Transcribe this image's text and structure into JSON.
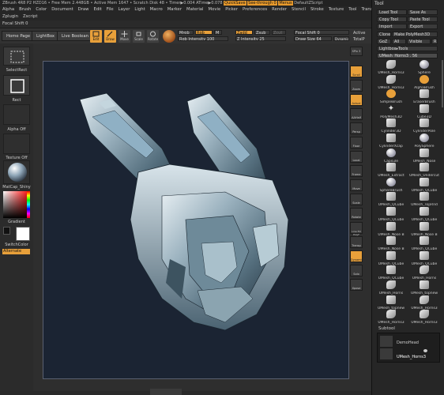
{
  "titlebar": {
    "app": "ZBrush 4R8 P2 HZD16",
    "stats": "• Free Mem 2.448GB • Active Mem 1647 • Scratch Disk 48 • Timer▶0.004 ATime▶0.078",
    "quicksave": "QuickSave",
    "seethrough": "See-through  0",
    "menus": "Menus",
    "script": "DefaultZScript"
  },
  "menus": {
    "row1": [
      "Alpha",
      "Brush",
      "Color",
      "Document",
      "Draw",
      "Edit",
      "File",
      "Layer",
      "Light",
      "Macro",
      "Marker",
      "Material",
      "Movie",
      "Picker",
      "Preferences",
      "Render",
      "Stencil",
      "Stroke",
      "Texture",
      "Tool",
      "Transform"
    ],
    "row2": [
      "Zplugin",
      "Zscript"
    ],
    "focal": "Focal Shift 0"
  },
  "topbar": {
    "tabs": [
      "Home Page",
      "LightBox",
      "Live Boolean"
    ],
    "edit": "Edit",
    "draw": "Draw",
    "move": "Move",
    "scale": "Scale",
    "rotate": "Rotate",
    "mrgb": "Mrgb",
    "rgb": "Rgb",
    "m": "M",
    "rgb_intensity": "Rgb Intensity 100",
    "zadd": "Zadd",
    "zsub": "Zsub",
    "zcut": "Zcut",
    "z_intensity": "Z Intensity 25",
    "focal_shift": "Focal Shift 0",
    "draw_size": "Draw Size 64",
    "dynamic": "Dynamic",
    "active": "Active",
    "total": "TotalP"
  },
  "left_shelf": {
    "select": "SelectRect",
    "rect": "Rect",
    "alpha": "Alpha Off",
    "texture": "Texture Off",
    "material": "MatCap_Shiny",
    "gradient": "Gradient",
    "switchcolor": "SwitchColor",
    "alternate": "Alternate"
  },
  "right_shelf": [
    "SPix 3",
    "Scroll",
    "Zoom",
    "Actual",
    "AAHalf",
    "Persp",
    "Floor",
    "Local",
    "Frame",
    "Move",
    "Scale",
    "Rotate",
    "Line Fill PolyF",
    "Transp",
    "Dynamic",
    "Solo",
    "Xpose"
  ],
  "tool_panel": {
    "title": "Tool",
    "load_tool": "Load Tool",
    "save_as": "Save As",
    "copy_tool": "Copy Tool",
    "paste_tool": "Paste Tool",
    "import": "Import",
    "export": "Export",
    "clone": "Clone",
    "make_polymesh": "Make PolyMesh3D",
    "goz": "GoZ",
    "all": "All",
    "visible": "Visible",
    "r": "R",
    "lightbox_tools": "Lightbox▸Tools",
    "current_tool": "UMesh_Horns3 . 56",
    "subtool": "Subtool",
    "subtool_items": [
      "DemoHead",
      "UMesh_Horns3"
    ],
    "brushes": [
      "UMesh_Horns3",
      "Sphere",
      "UMesh_Horns3",
      "AlphaBrush",
      "SimpleBrush",
      "EraserBrush",
      "PolyMesh3D",
      "Cube3D",
      "Cylinder3D",
      "CylinderPole",
      "CylinderXcap",
      "PolySphere",
      "Capsule",
      "UMesh_Nose",
      "UMesh_Extract",
      "UMesh_Undercut",
      "SphereBrush",
      "UMesh_QCube",
      "UMesh_QCube",
      "UMesh_TopRnd",
      "UMesh_QCube",
      "UMesh_QCube",
      "UMesh_Nose B",
      "UMesh_Nose B",
      "UMesh_Nose B",
      "UMesh_QCube",
      "UMesh_QCube",
      "UMesh_QCube",
      "UMesh_QCube",
      "UMesh_Horns",
      "UMesh_Horns",
      "UMesh_topnew",
      "UMesh_topnew",
      "UMesh_Horns3",
      "UMesh_Horns3",
      "UMesh_Horns3"
    ]
  },
  "colors": {
    "accent": "#e8a03a",
    "bg": "#2a2a2a",
    "canvas": "#1b2433"
  }
}
